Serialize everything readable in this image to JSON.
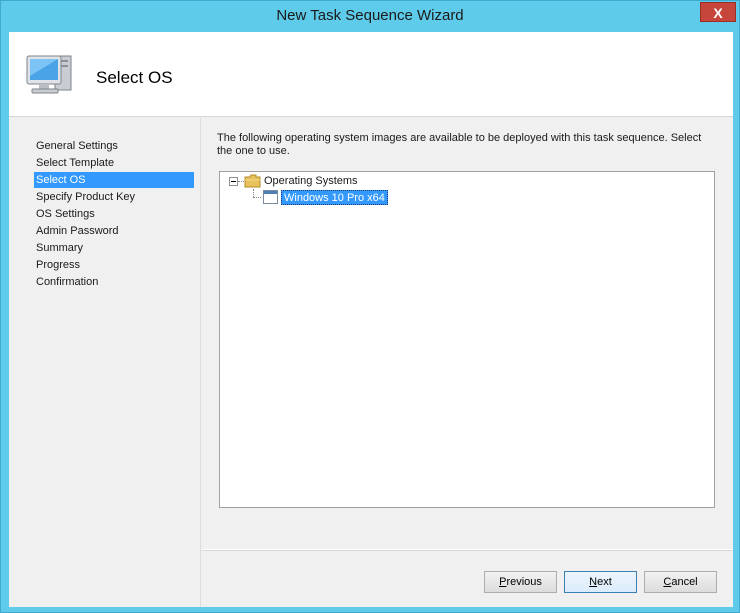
{
  "window": {
    "title": "New Task Sequence Wizard",
    "close_glyph": "X"
  },
  "header": {
    "title": "Select OS",
    "icon": "computer-monitor-icon"
  },
  "sidebar": {
    "items": [
      {
        "label": "General Settings",
        "active": false
      },
      {
        "label": "Select Template",
        "active": false
      },
      {
        "label": "Select OS",
        "active": true
      },
      {
        "label": "Specify Product Key",
        "active": false
      },
      {
        "label": "OS Settings",
        "active": false
      },
      {
        "label": "Admin Password",
        "active": false
      },
      {
        "label": "Summary",
        "active": false
      },
      {
        "label": "Progress",
        "active": false
      },
      {
        "label": "Confirmation",
        "active": false
      }
    ]
  },
  "main": {
    "description": "The following operating system images are available to be deployed with this task sequence.  Select the one to use.",
    "tree": {
      "root_label": "Operating Systems",
      "root_icon": "folder-icon",
      "child_label": "Windows 10 Pro x64",
      "child_icon": "os-image-icon"
    }
  },
  "footer": {
    "previous_label": "Previous",
    "previous_mnemonic": "P",
    "previous_rest": "revious",
    "next_label": "Next",
    "next_mnemonic": "N",
    "next_rest": "ext",
    "cancel_label": "Cancel",
    "cancel_mnemonic": "C",
    "cancel_rest": "ancel"
  },
  "colors": {
    "titlebar": "#5ecbea",
    "selection": "#3399ff",
    "close_button": "#c7463b"
  }
}
